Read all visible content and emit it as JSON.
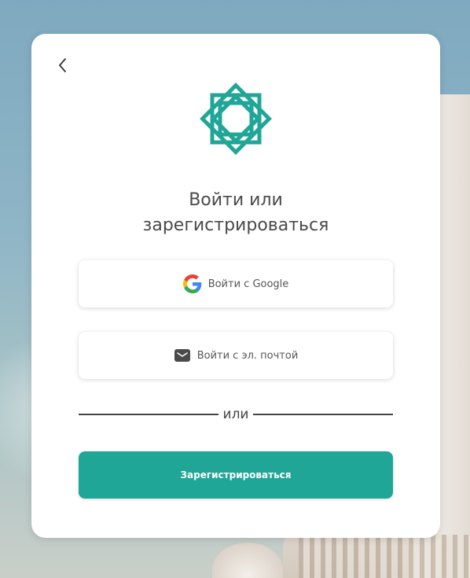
{
  "dialog": {
    "title_line1": "Войти или",
    "title_line2": "зарегистрироваться",
    "back_icon": "chevron-left-icon",
    "logo_icon": "eight-point-star-icon"
  },
  "auth": {
    "google_label": "Войти с Google",
    "google_icon": "google-icon",
    "email_label": "Войти с эл. почтой",
    "email_icon": "mail-icon",
    "divider_text": "или",
    "register_label": "Зарегистрироваться"
  },
  "colors": {
    "accent": "#1fa696",
    "text": "#4a4a4a"
  }
}
